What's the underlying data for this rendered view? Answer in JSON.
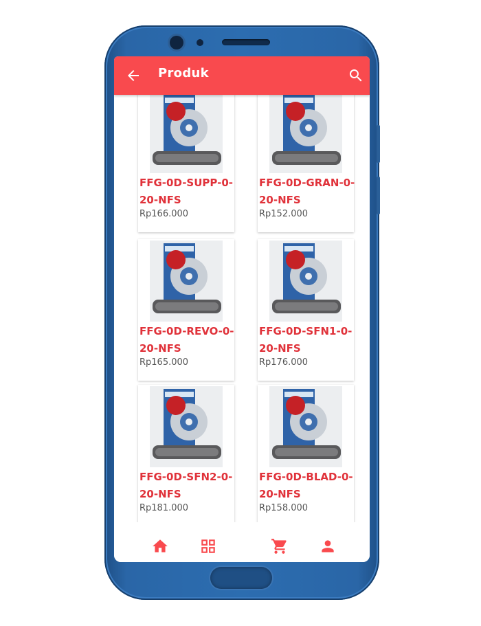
{
  "appbar": {
    "title": "Produk",
    "back_icon": "arrow-back-icon",
    "search_icon": "search-icon",
    "color": "#f94a4e"
  },
  "products": [
    {
      "name": "FFG-0D-SUPP-0-20-NFS",
      "price": "Rp166.000"
    },
    {
      "name": "FFG-0D-GRAN-0-20-NFS",
      "price": "Rp152.000"
    },
    {
      "name": "FFG-0D-REVO-0-20-NFS",
      "price": "Rp165.000"
    },
    {
      "name": "FFG-0D-SFN1-0-20-NFS",
      "price": "Rp176.000"
    },
    {
      "name": "FFG-0D-SFN2-0-20-NFS",
      "price": "Rp181.000"
    },
    {
      "name": "FFG-0D-BLAD-0-20-NFS",
      "price": "Rp158.000"
    }
  ],
  "bottom_nav": {
    "items": [
      "home-icon",
      "grid-icon",
      "cart-icon",
      "person-icon"
    ],
    "color": "#f94a4e"
  },
  "device": {
    "color": "#2c6db0"
  }
}
